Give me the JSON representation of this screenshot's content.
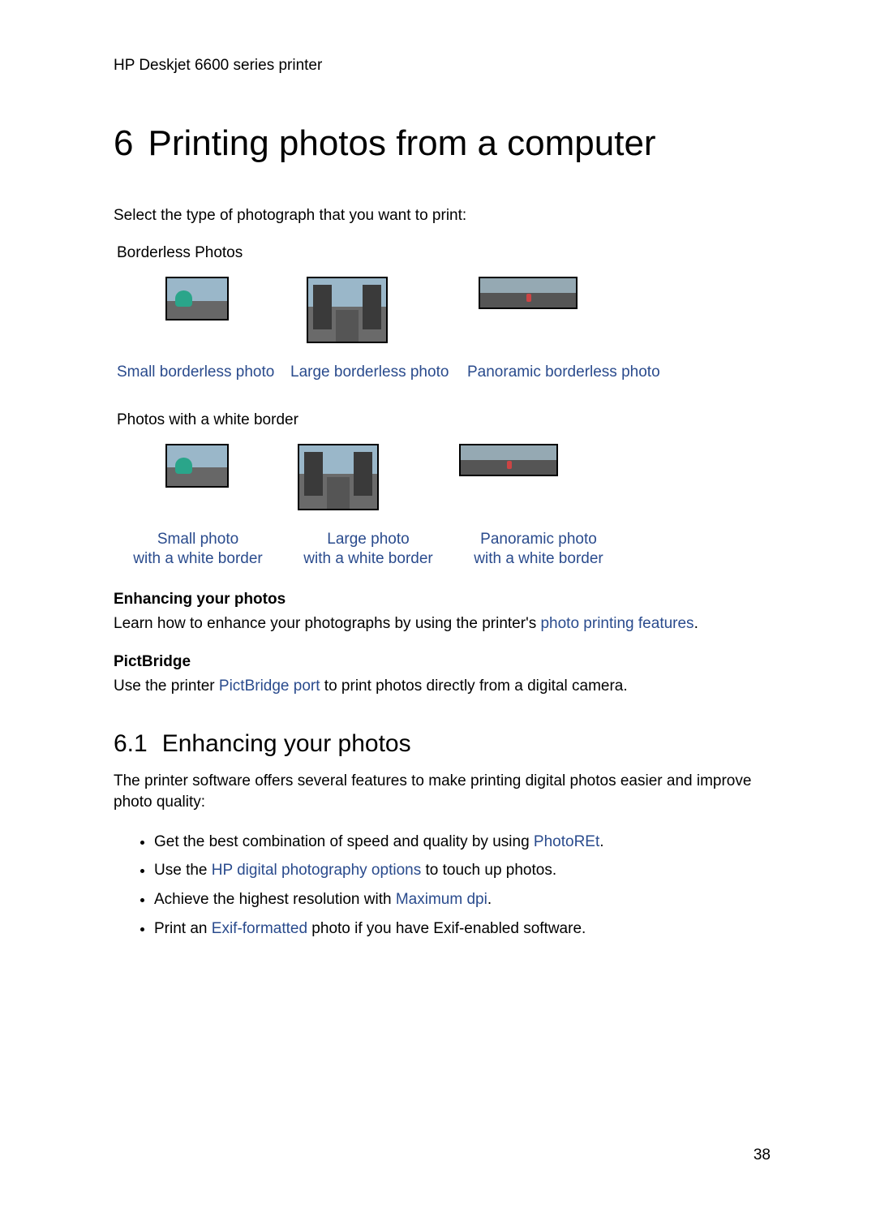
{
  "header": "HP Deskjet 6600 series printer",
  "chapter": {
    "num": "6",
    "title": "Printing photos from a computer"
  },
  "intro": "Select the type of photograph that you want to print:",
  "section_borderless_label": "Borderless Photos",
  "borderless_captions": {
    "a": "Small borderless photo",
    "b": "Large borderless photo",
    "c": "Panoramic borderless photo"
  },
  "section_whiteborder_label": "Photos with a white border",
  "whiteborder_captions": {
    "a1": "Small photo",
    "a2": "with a white border",
    "b1": "Large photo",
    "b2": "with a white border",
    "c1": "Panoramic photo",
    "c2": "with a white border"
  },
  "enh_heading": "Enhancing your photos",
  "enh_text_pre": "Learn how to enhance your photographs by using the printer's ",
  "enh_link": "photo printing features",
  "enh_text_post": ".",
  "pict_heading": "PictBridge",
  "pict_pre": "Use the printer ",
  "pict_link": "PictBridge port",
  "pict_post": " to print photos directly from a digital camera.",
  "sec61": {
    "num": "6.1",
    "title": "Enhancing your photos"
  },
  "sec61_intro": "The printer software offers several features to make printing digital photos easier and improve photo quality:",
  "bullets": {
    "b1_pre": "Get the best combination of speed and quality by using ",
    "b1_link": "PhotoREt",
    "b1_post": ".",
    "b2_pre": "Use the ",
    "b2_link": "HP digital photography options",
    "b2_post": " to touch up photos.",
    "b3_pre": "Achieve the highest resolution with ",
    "b3_link": "Maximum dpi",
    "b3_post": ".",
    "b4_pre": "Print an ",
    "b4_link": "Exif-formatted",
    "b4_post": " photo if you have Exif-enabled software."
  },
  "page_number": "38"
}
